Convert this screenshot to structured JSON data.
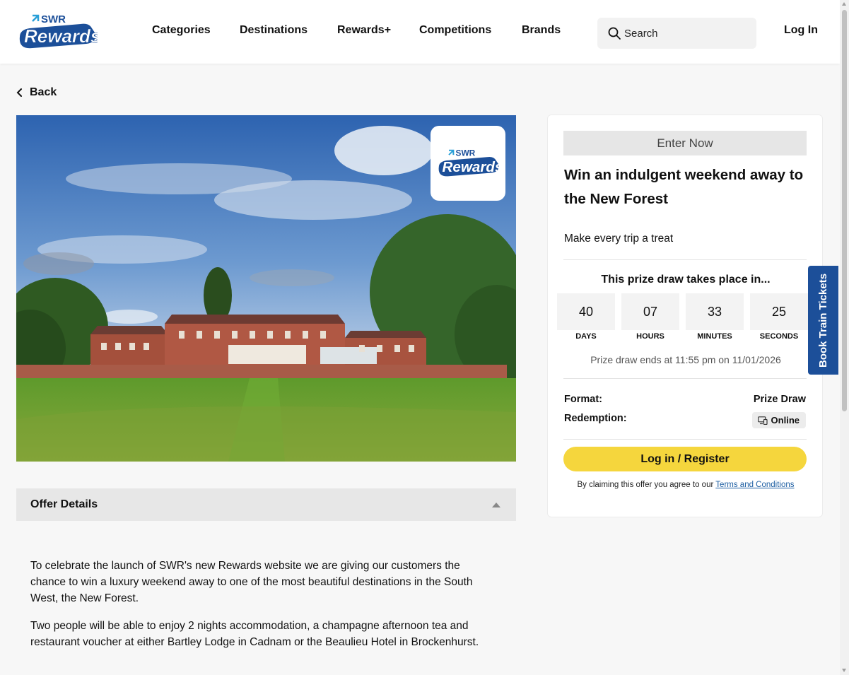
{
  "header": {
    "logo_text_top": "SWR",
    "logo_text_main": "Rewards",
    "nav": [
      {
        "label": "Categories"
      },
      {
        "label": "Destinations"
      },
      {
        "label": "Rewards+"
      },
      {
        "label": "Competitions"
      },
      {
        "label": "Brands"
      }
    ],
    "search_placeholder": "Search",
    "login_label": "Log In"
  },
  "back_label": "Back",
  "offer": {
    "details_title": "Offer Details",
    "paragraphs": [
      "To celebrate the launch of SWR's new Rewards website we are giving our customers the chance to win a luxury weekend away to one of the most beautiful destinations in the South West, the New Forest.",
      "Two people will be able to enjoy 2 nights accommodation, a champagne afternoon tea and restaurant voucher at either Bartley Lodge in Cadnam or the Beaulieu Hotel in Brockenhurst."
    ]
  },
  "card": {
    "enter_label": "Enter Now",
    "title": "Win an indulgent weekend away to the New Forest",
    "subtitle": "Make every trip a treat",
    "draw_heading": "This prize draw takes place in...",
    "countdown": [
      {
        "value": "40",
        "label": "DAYS"
      },
      {
        "value": "07",
        "label": "HOURS"
      },
      {
        "value": "33",
        "label": "MINUTES"
      },
      {
        "value": "25",
        "label": "SECONDS"
      }
    ],
    "draw_ends": "Prize draw ends at 11:55 pm on 11/01/2026",
    "format_label": "Format:",
    "format_value": "Prize Draw",
    "redemption_label": "Redemption:",
    "redemption_value": "Online",
    "login_register_label": "Log in / Register",
    "terms_prefix": "By claiming this offer you agree to our ",
    "terms_link": "Terms and Conditions"
  },
  "side_tab_label": "Book Train Tickets",
  "colors": {
    "brand_blue": "#1c4f99",
    "accent_yellow": "#f5d63d"
  }
}
